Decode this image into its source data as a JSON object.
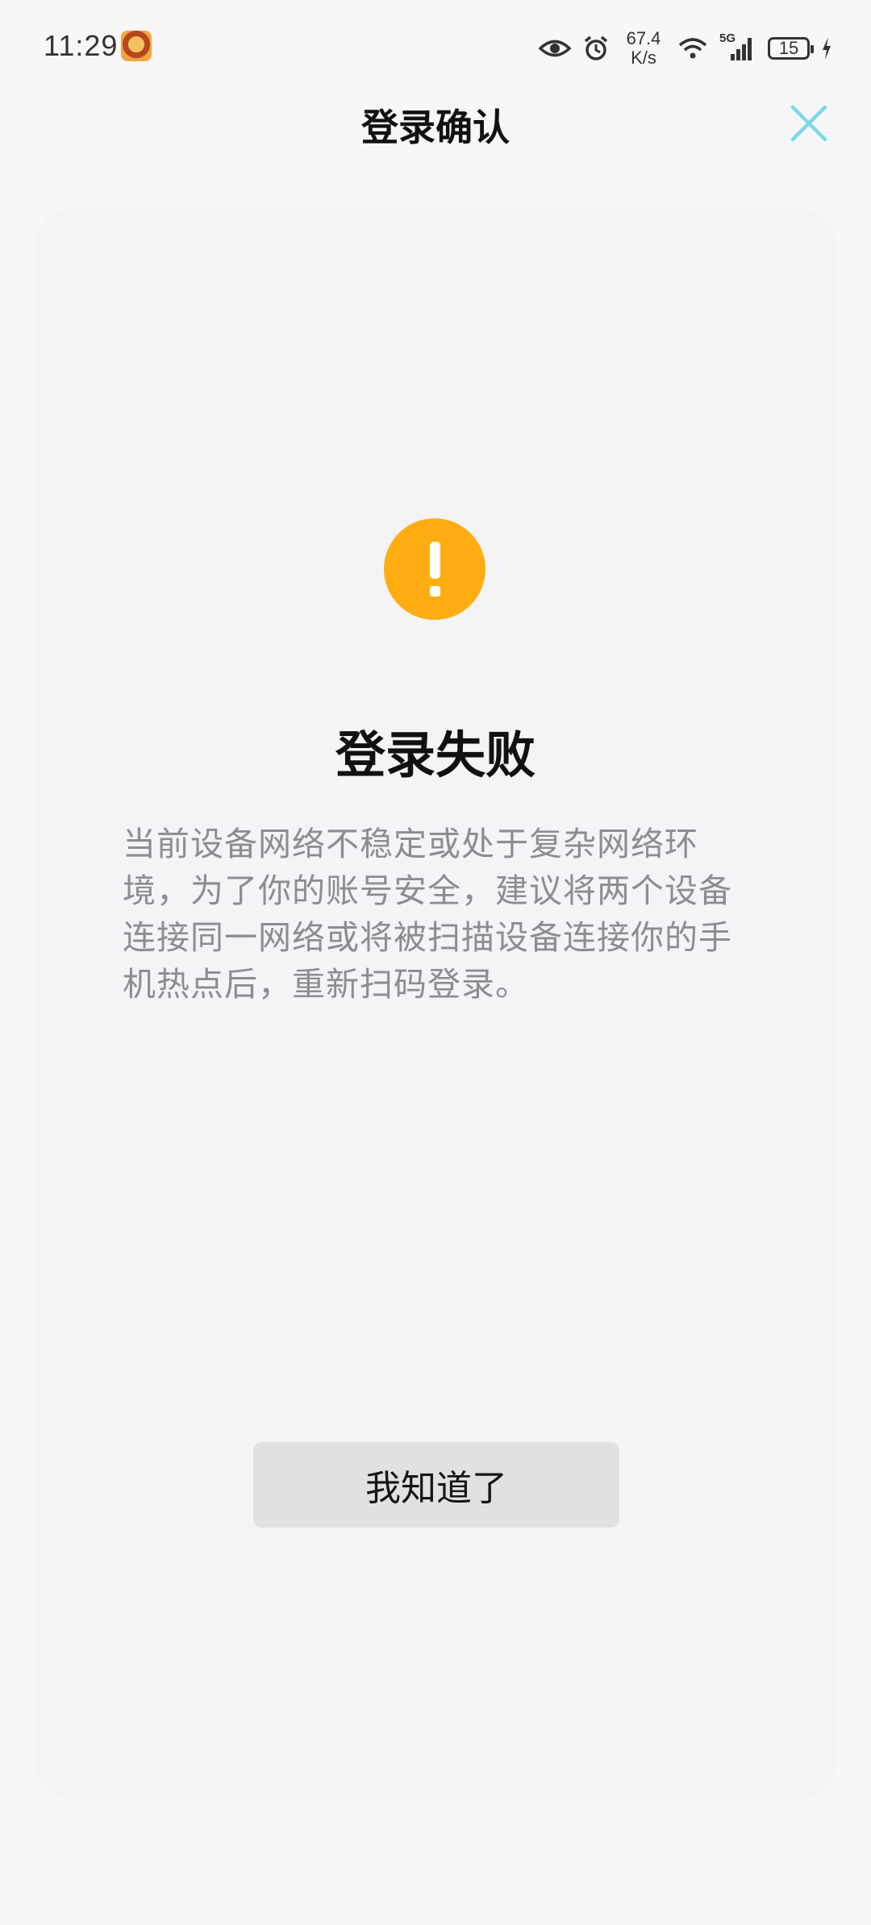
{
  "status_bar": {
    "time": "11:29",
    "network_speed_value": "67.4",
    "network_speed_unit": "K/s",
    "signal_label": "5G",
    "battery_level": "15",
    "icons": [
      "app-avatar-icon",
      "eye-icon",
      "alarm-icon",
      "wifi-icon",
      "signal-icon",
      "battery-icon",
      "charging-icon"
    ]
  },
  "header": {
    "title": "登录确认",
    "close_icon": "close-icon",
    "accent_color": "#7dd8e6"
  },
  "result": {
    "icon": "warning-icon",
    "icon_color": "#ffad12",
    "title": "登录失败",
    "description": "当前设备网络不稳定或处于复杂网络环境，为了你的账号安全，建议将两个设备连接同一网络或将被扫描设备连接你的手机热点后，重新扫码登录。"
  },
  "actions": {
    "confirm_label": "我知道了"
  }
}
